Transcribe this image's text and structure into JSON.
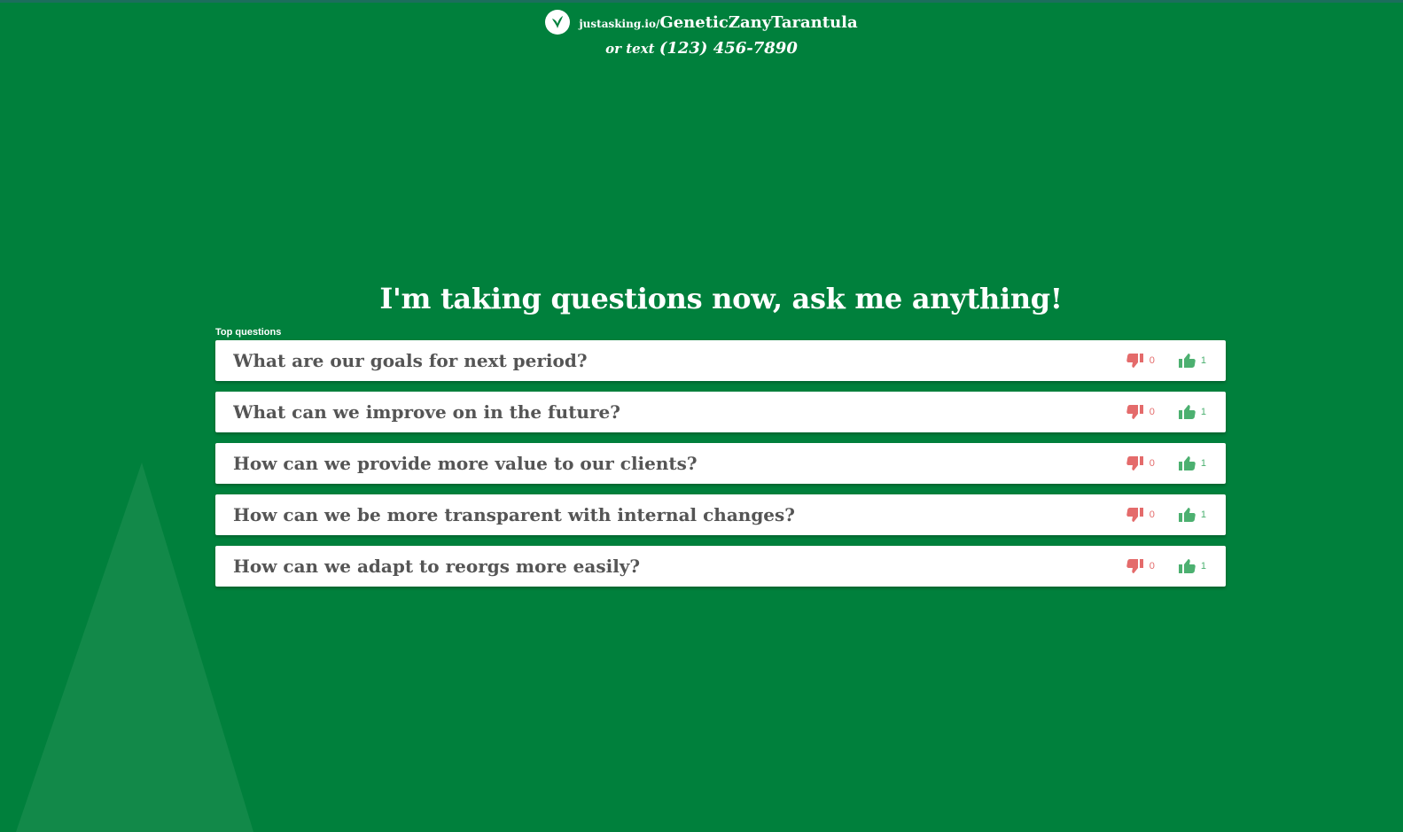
{
  "header": {
    "url_prefix": "justasking.io/",
    "url_slug": "GeneticZanyTarantula",
    "text_prefix": "or text",
    "phone": "(123) 456-7890"
  },
  "headline": "I'm taking questions now, ask me anything!",
  "section_label": "Top questions",
  "questions": [
    {
      "text": "What are our goals for next period?",
      "downvotes": "0",
      "upvotes": "1"
    },
    {
      "text": "What can we improve on in the future?",
      "downvotes": "0",
      "upvotes": "1"
    },
    {
      "text": "How can we provide more value to our clients?",
      "downvotes": "0",
      "upvotes": "1"
    },
    {
      "text": "How can we be more transparent with internal changes?",
      "downvotes": "0",
      "upvotes": "1"
    },
    {
      "text": "How can we adapt to reorgs more easily?",
      "downvotes": "0",
      "upvotes": "1"
    }
  ],
  "icons": {
    "logo": "justasking-logo-icon",
    "downvote": "thumbs-down-icon",
    "upvote": "thumbs-up-icon"
  },
  "colors": {
    "background": "#00803c",
    "downvote": "#e46b6b",
    "upvote": "#4cb070",
    "question_text": "#555555"
  }
}
